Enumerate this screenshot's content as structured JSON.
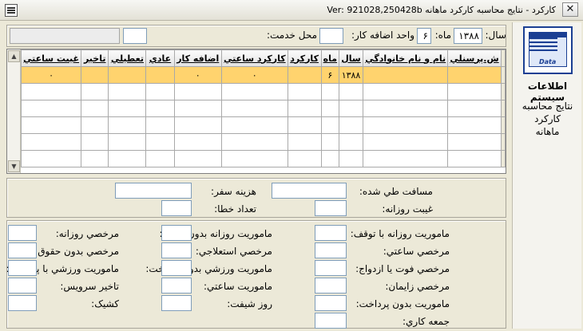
{
  "window": {
    "title": "Ver: 921028,250428b    کارکرد - نتایج محاسبه کارکرد ماهانه",
    "close_glyph": "✕"
  },
  "header": {
    "year_label": "سال:",
    "year_value": "۱۳۸۸",
    "month_label": "ماه:",
    "month_value": "۶",
    "overtime_unit_label": "واحد اضافه کار:",
    "overtime_unit_value": "",
    "service_place_label": "محل خدمت:",
    "service_place_code": "",
    "service_place_name": ""
  },
  "grid": {
    "columns": [
      "ش.پرسنلي",
      "نام و نام خانوادگي",
      "سال",
      "ماه",
      "کارکرد",
      "کارکرد ساعتي",
      "اضافه کار",
      "عادي",
      "تعطيلي",
      "تاخير",
      "غيبت ساعتي"
    ],
    "rows": [
      [
        "",
        "",
        "۱۳۸۸",
        "۶",
        "",
        "۰",
        "۰",
        "",
        "",
        "",
        "۰"
      ]
    ]
  },
  "middle": {
    "distance_label": "مسافت طي شده:",
    "travel_cost_label": "هزينه سفر:",
    "daily_absence_label": "غيبت روزانه:",
    "error_count_label": "تعداد خطا:"
  },
  "bottom": {
    "col_right": [
      "ماموريت روزانه با توقف:",
      "مرخصي ساعتي:",
      "مرخصي فوت يا ازدواج:",
      "مرخصي زايمان:",
      "ماموريت بدون پرداخت:",
      "جمعه کاري:"
    ],
    "col_middle": [
      "ماموريت روزانه بدون توقف:",
      "مرخصي استعلاجي:",
      "ماموريت ورزشي بدون پرداخت:",
      "ماموريت ساعتي:",
      "روز شيفت:"
    ],
    "col_left": [
      "مرخصي روزانه:",
      "مرخصي بدون حقوق:",
      "ماموريت ورزشي با پرداخت:",
      "تاخير سرويس:",
      "کشيک:"
    ]
  },
  "sidebar": {
    "logo_text": "Data",
    "title": "اطلاعات سيستم",
    "subtitle_lines": [
      "نتايج محاسبه",
      "کارکرد",
      "ماهانه"
    ]
  },
  "colors": {
    "window_bg": "#ece9d8",
    "selected_row": "#ffd36e",
    "logo_blue": "#1b3f93"
  }
}
